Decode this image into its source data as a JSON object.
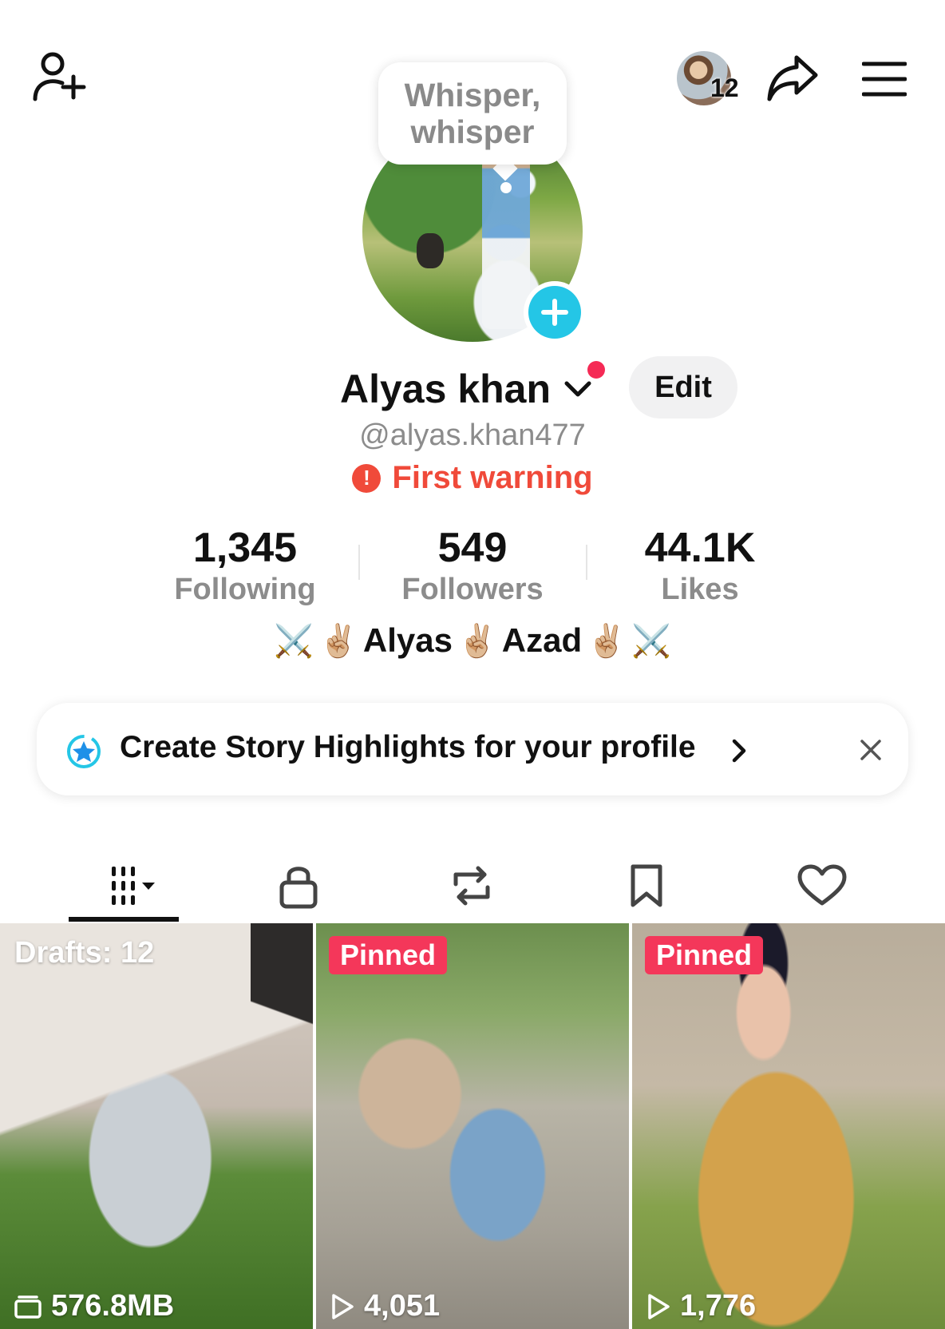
{
  "header": {
    "add_friend_icon": "person-plus-icon",
    "friends_count": "12",
    "share_icon": "share-arrow-icon",
    "menu_icon": "hamburger-menu-icon"
  },
  "profile": {
    "bubble_text": "Whisper, whisper",
    "display_name": "Alyas khan",
    "edit_label": "Edit",
    "username": "@alyas.khan477",
    "warning_text": "First warning",
    "warning_glyph": "!",
    "accent_color": "#24c6e6",
    "warning_color": "#f04a3a"
  },
  "stats": [
    {
      "value": "1,345",
      "label": "Following"
    },
    {
      "value": "549",
      "label": "Followers"
    },
    {
      "value": "44.1K",
      "label": "Likes"
    }
  ],
  "bio": {
    "swords": "⚔️",
    "hand": "✌🏼",
    "name1": "Alyas",
    "name2": "Azad"
  },
  "banner": {
    "text": "Create Story Highlights for your profile"
  },
  "tabs": [
    {
      "name": "videos-grid",
      "icon": "grid-columns-icon"
    },
    {
      "name": "private",
      "icon": "lock-icon"
    },
    {
      "name": "reposts",
      "icon": "repost-icon"
    },
    {
      "name": "favorites",
      "icon": "bookmark-icon"
    },
    {
      "name": "liked",
      "icon": "heart-icon"
    }
  ],
  "grid": [
    {
      "label": "Drafts: 12",
      "footer": "576.8MB",
      "footer_icon": "folder-icon"
    },
    {
      "badge": "Pinned",
      "footer": "4,051",
      "footer_icon": "play-icon"
    },
    {
      "badge": "Pinned",
      "footer": "1,776",
      "footer_icon": "play-icon"
    }
  ],
  "colors": {
    "pinned": "#f4375a",
    "notification_dot": "#f52a55"
  }
}
